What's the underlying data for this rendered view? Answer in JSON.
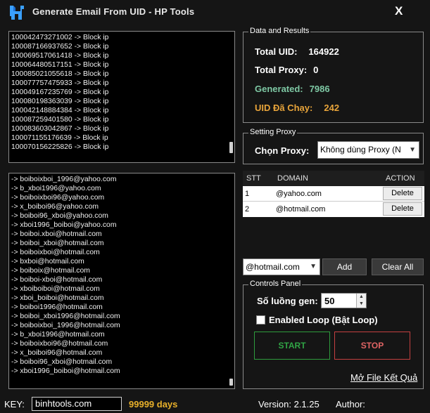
{
  "app": {
    "title": "Generate Email From UID - HP Tools",
    "close_label": "X",
    "logo_icon": "hp-tools-logo"
  },
  "log_box": {
    "lines": [
      "100042473271002 -> Block ip",
      "100087166937652 -> Block ip",
      "100069517061418 -> Block ip",
      "100064480517151 -> Block ip",
      "100085021055618 -> Block ip",
      "100077757475933 -> Block ip",
      "100049167235769 -> Block ip",
      "100080198363039 -> Block ip",
      "100042148884384 -> Block ip",
      "100087259401580 -> Block ip",
      "100083603042867 -> Block ip",
      "100071155176639 -> Block ip",
      "100070156225826 -> Block ip"
    ]
  },
  "email_box": {
    "lines": [
      "-> boiboixboi_1996@yahoo.com",
      "-> b_xboi1996@yahoo.com",
      "-> boiboixboi96@yahoo.com",
      "-> x_boiboi96@yahoo.com",
      "-> boiboi96_xboi@yahoo.com",
      "-> xboi1996_boiboi@yahoo.com",
      "-> boiboi.xboi@hotmail.com",
      "-> boiboi_xboi@hotmail.com",
      "-> boiboixboi@hotmail.com",
      "-> bxboi@hotmail.com",
      "-> boiboix@hotmail.com",
      "-> boiboi-xboi@hotmail.com",
      "-> xboiboiboi@hotmail.com",
      "-> xboi_boiboi@hotmail.com",
      "-> boiboi1996@hotmail.com",
      "-> boiboi_xboi1996@hotmail.com",
      "-> boiboixboi_1996@hotmail.com",
      "-> b_xboi1996@hotmail.com",
      "-> boiboixboi96@hotmail.com",
      "-> x_boiboi96@hotmail.com",
      "-> boiboi96_xboi@hotmail.com",
      "-> xboi1996_boiboi@hotmail.com"
    ]
  },
  "data_results": {
    "title": "Data and Results",
    "total_uid_label": "Total UID:",
    "total_uid_value": "164922",
    "total_proxy_label": "Total Proxy:",
    "total_proxy_value": "0",
    "generated_label": "Generated:",
    "generated_value": "7986",
    "uid_run_label": "UID Đã Chạy:",
    "uid_run_value": "242",
    "colors": {
      "generated": "#7ec8a4",
      "uid_run": "#e8a43a"
    }
  },
  "setting_proxy": {
    "title": "Setting Proxy",
    "choose_label": "Chọn Proxy:",
    "selected": "Không dùng Proxy (N"
  },
  "domain_table": {
    "headers": [
      "STT",
      "DOMAIN",
      "ACTION"
    ],
    "rows": [
      {
        "stt": "1",
        "domain": "@yahoo.com",
        "action": "Delete"
      },
      {
        "stt": "2",
        "domain": "@hotmail.com",
        "action": "Delete"
      }
    ]
  },
  "domain_controls": {
    "selected": "@hotmail.com",
    "add_label": "Add",
    "clear_label": "Clear All"
  },
  "controls_panel": {
    "title": "Controls Panel",
    "threads_label": "Số luồng gen:",
    "threads_value": "50",
    "loop_label": "Enabled Loop (Bật Loop)",
    "start_label": "START",
    "stop_label": "STOP",
    "open_file_label": "Mở File Kết Quả"
  },
  "status": {
    "key_label": "KEY:",
    "key_value": "binhtools.com",
    "days": "99999 days",
    "version": "Version: 2.1.25",
    "author": "Author:"
  }
}
